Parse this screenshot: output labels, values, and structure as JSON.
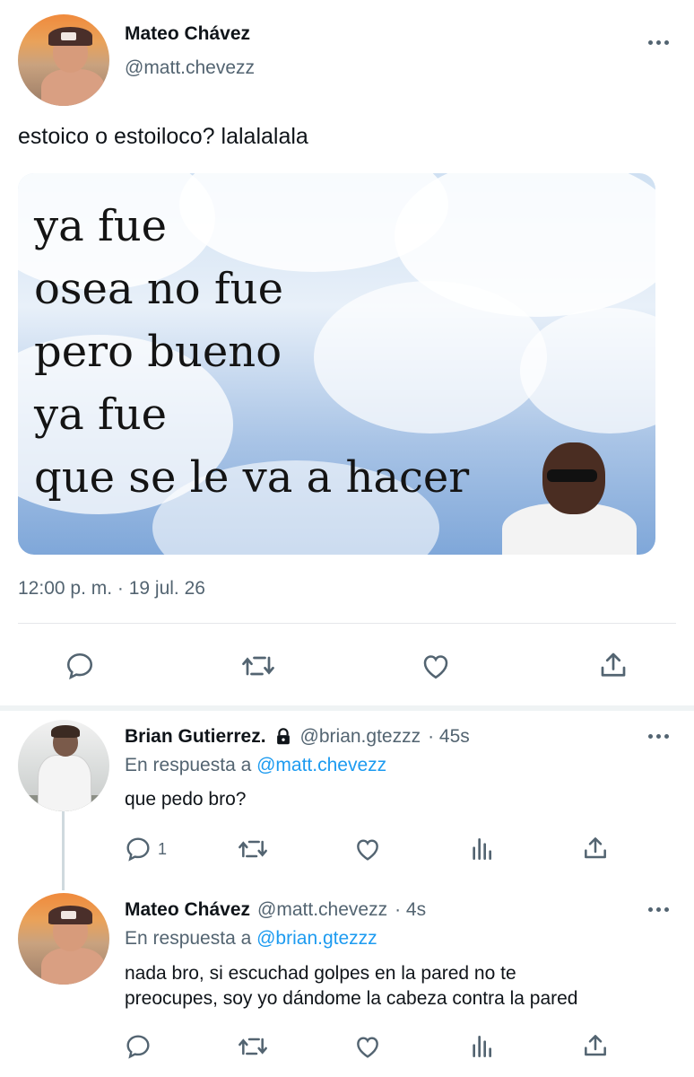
{
  "main_tweet": {
    "author_name": "Mateo Chávez",
    "author_handle": "@matt.chevezz",
    "text": "estoico o estoiloco? lalalalala",
    "media_text": [
      "ya fue",
      "osea no fue",
      "pero bueno",
      "ya fue",
      "que se le va a hacer"
    ],
    "timestamp": "12:00 p. m. · 19 jul. 26",
    "actions": [
      "reply-icon",
      "retweet-icon",
      "like-icon",
      "share-icon"
    ]
  },
  "replies": [
    {
      "author_name": "Brian Gutierrez.",
      "locked": true,
      "author_handle": "@brian.gtezzz",
      "time": "· 45s",
      "reply_to_label": "En respuesta a",
      "reply_to": "@matt.chevezz",
      "text": "que pedo bro?",
      "reply_count": "1",
      "actions": [
        "reply-icon",
        "retweet-icon",
        "like-icon",
        "views-icon",
        "share-icon"
      ]
    },
    {
      "author_name": "Mateo Chávez",
      "author_handle": "@matt.chevezz",
      "time": "· 4s",
      "reply_to_label": "En respuesta a",
      "reply_to": "@brian.gtezzz",
      "text_lines": [
        "nada bro, si escuchad golpes en la pared no te",
        "preocupes, soy yo dándome la cabeza contra la pared"
      ],
      "actions": [
        "reply-icon",
        "retweet-icon",
        "like-icon",
        "views-icon",
        "share-icon"
      ]
    }
  ],
  "colors": {
    "text": "#0f1419",
    "secondary": "#536471",
    "link": "#1d9bf0",
    "divider": "#e5e7ea"
  }
}
